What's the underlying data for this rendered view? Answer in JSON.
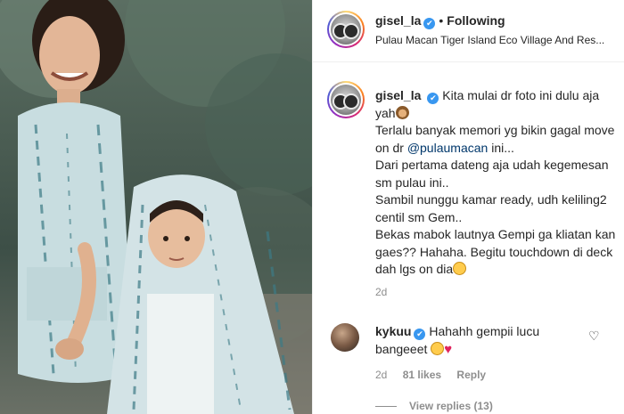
{
  "post": {
    "author": "gisel_la",
    "verified_mark": "✔",
    "follow_status": "Following",
    "separator": "•",
    "location": "Pulau Macan Tiger Island Eco Village And Res...",
    "caption_parts": {
      "line1": "Kita mulai dr foto ini dulu aja yah",
      "line2": "Terlalu banyak memori yg bikin gagal move on dr ",
      "mention": "@pulaumacan",
      "line2_end": " ini...",
      "line3": "Dari pertama dateng aja udah kegemesan sm pulau ini..",
      "line4": "Sambil nunggu kamar ready, udh keliling2 centil sm Gem..",
      "line5": "Bekas mabok lautnya Gempi ga kliatan kan gaes?? Hahaha. Begitu touchdown di deck dah lgs on dia"
    },
    "time_ago": "2d"
  },
  "comment": {
    "author": "kykuu",
    "text": "Hahahh gempii lucu bangeeet",
    "heart_icon": "♥",
    "like_icon": "♡",
    "time_ago": "2d",
    "likes": "81 likes",
    "reply_label": "Reply",
    "view_replies": "View replies (13)"
  },
  "icons": {
    "verified": "verified-badge-icon",
    "avatar": "profile-avatar"
  },
  "colors": {
    "verified": "#3897f0",
    "mention": "#00376b",
    "muted": "#8e8e8e",
    "heart": "#e0245e"
  }
}
